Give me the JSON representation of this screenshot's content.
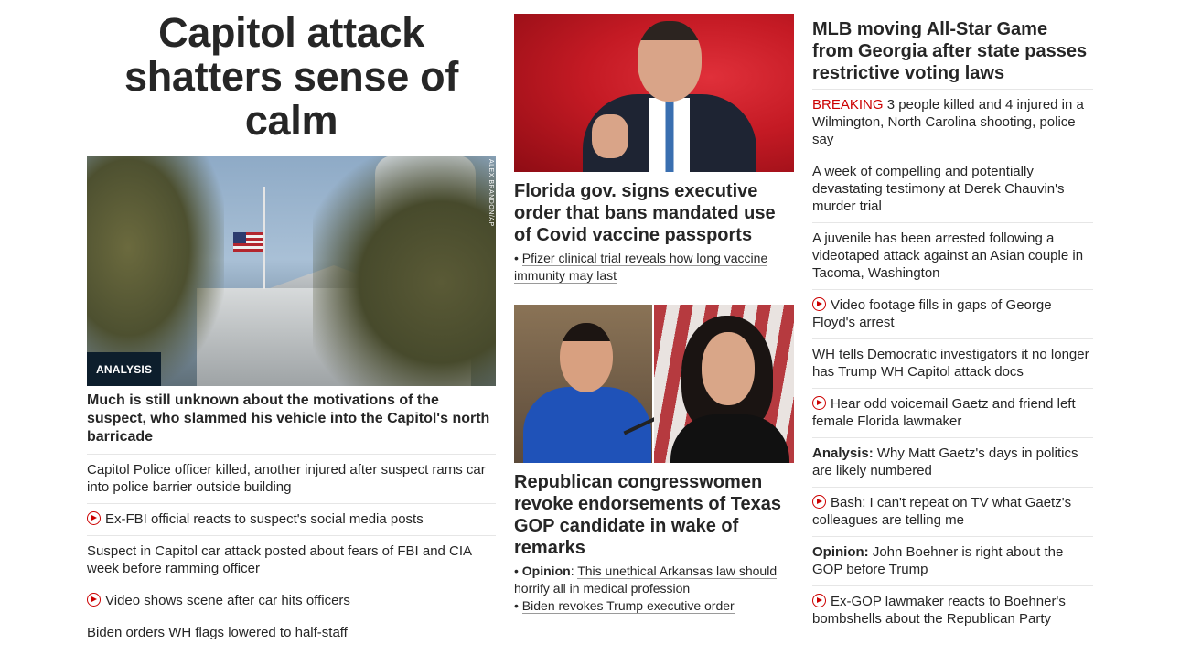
{
  "col1": {
    "headline": "Capitol attack shatters sense of calm",
    "image_credit": "ALEX BRANDON/AP",
    "badge": "ANALYSIS",
    "subheadline": "Much is still unknown about the motivations of the suspect, who slammed his vehicle into the Capitol's north barricade",
    "items": [
      {
        "text": "Capitol Police officer killed, another injured after suspect rams car into police barrier outside building",
        "video": false
      },
      {
        "text": "Ex-FBI official reacts to suspect's social media posts",
        "video": true
      },
      {
        "text": "Suspect in Capitol car attack posted about fears of FBI and CIA week before ramming officer",
        "video": false
      },
      {
        "text": "Video shows scene after car hits officers",
        "video": true
      },
      {
        "text": "Biden orders WH flags lowered to half-staff",
        "video": false
      }
    ]
  },
  "col2": {
    "story1": {
      "title": "Florida gov. signs executive order that bans mandated use of Covid vaccine passports",
      "link": "Pfizer clinical trial reveals how long vaccine immunity may last"
    },
    "story2": {
      "title": "Republican congresswomen revoke endorsements of Texas GOP candidate in wake of remarks",
      "opinion_label": "Opinion",
      "opinion_link": "This unethical Arkansas law should horrify all in medical profession",
      "link2": "Biden revokes Trump executive order"
    }
  },
  "col3": {
    "title": "MLB moving All-Star Game from Georgia after state passes restrictive voting laws",
    "items": [
      {
        "prefix": "BREAKING",
        "text": "3 people killed and 4 injured in a Wilmington, North Carolina shooting, police say"
      },
      {
        "text": "A week of compelling and potentially devastating testimony at Derek Chauvin's murder trial"
      },
      {
        "text": "A juvenile has been arrested following a videotaped attack against an Asian couple in Tacoma, Washington"
      },
      {
        "text": "Video footage fills in gaps of George Floyd's arrest",
        "video": true
      },
      {
        "text": "WH tells Democratic investigators it no longer has Trump WH Capitol attack docs"
      },
      {
        "text": "Hear odd voicemail Gaetz and friend left female Florida lawmaker",
        "video": true
      },
      {
        "label": "Analysis:",
        "text": "Why Matt Gaetz's days in politics are likely numbered"
      },
      {
        "text": "Bash: I can't repeat on TV what Gaetz's colleagues are telling me",
        "video": true
      },
      {
        "label": "Opinion:",
        "text": "John Boehner is right about the GOP before Trump"
      },
      {
        "text": "Ex-GOP lawmaker reacts to Boehner's bombshells about the Republican Party",
        "video": true
      }
    ]
  },
  "colors": {
    "breaking": "#cc0000",
    "badge_bg": "#0d1e2c",
    "text": "#262626"
  }
}
